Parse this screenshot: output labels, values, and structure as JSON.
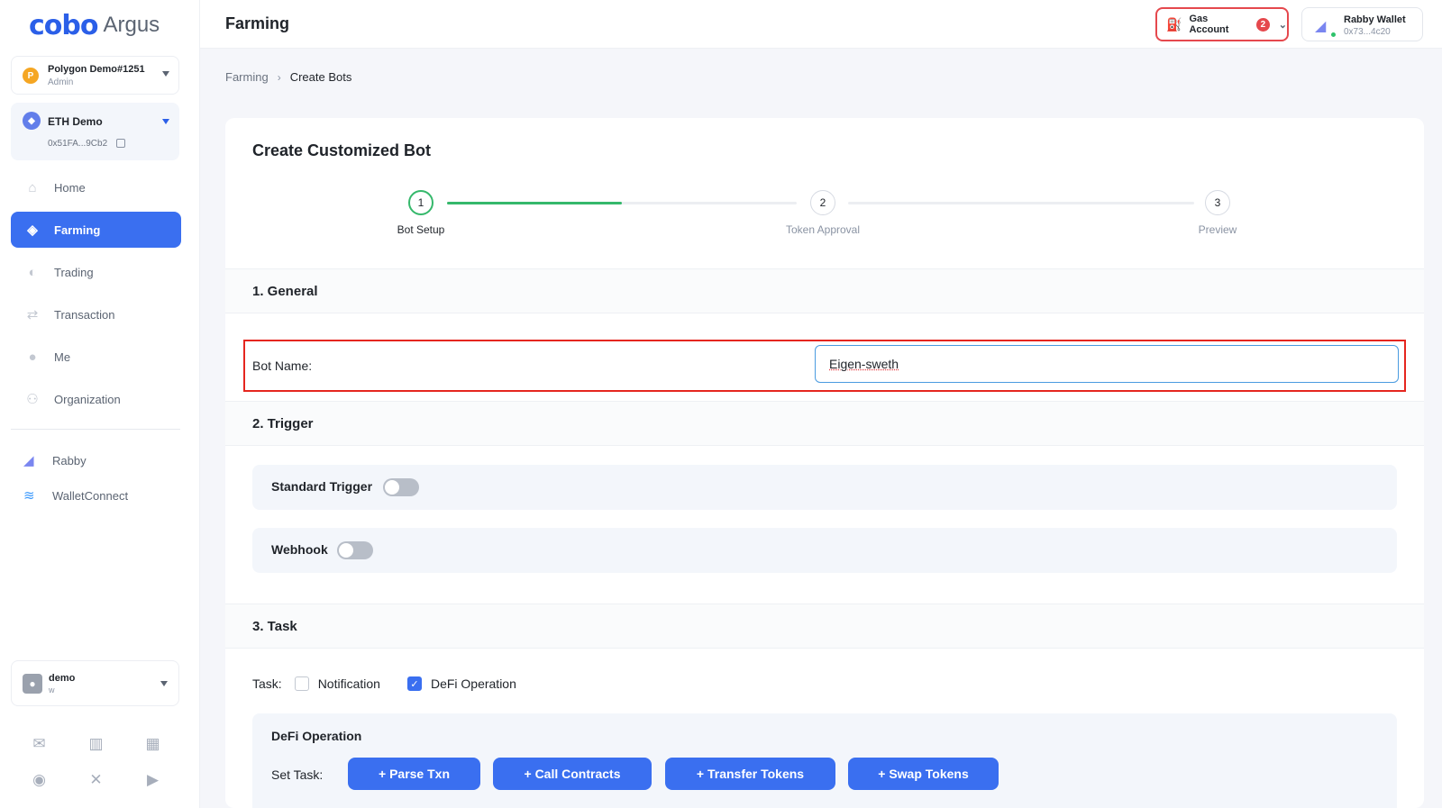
{
  "brand": {
    "mark": "cobo",
    "word": "Argus"
  },
  "accounts": [
    {
      "initial": "P",
      "name": "Polygon Demo#1251",
      "sub": "Admin"
    },
    {
      "initial": "◆",
      "name": "ETH Demo",
      "sub": "0x51FA...9Cb2"
    }
  ],
  "nav": [
    {
      "label": "Home",
      "icon": "home-icon",
      "glyph": "⌂"
    },
    {
      "label": "Farming",
      "icon": "farming-icon",
      "glyph": "◈"
    },
    {
      "label": "Trading",
      "icon": "trading-icon",
      "glyph": "◐"
    },
    {
      "label": "Transaction",
      "icon": "transaction-icon",
      "glyph": "⇄"
    },
    {
      "label": "Me",
      "icon": "person-icon",
      "glyph": "●"
    },
    {
      "label": "Organization",
      "icon": "group-icon",
      "glyph": "⚇"
    }
  ],
  "extensions": [
    {
      "label": "Rabby",
      "icon": "rabby-icon",
      "glyph": "◢"
    },
    {
      "label": "WalletConnect",
      "icon": "walletconnect-icon",
      "glyph": "≋"
    }
  ],
  "user": {
    "name": "demo",
    "sub": "w"
  },
  "footer_icons": [
    "mail-icon",
    "book-icon",
    "map-icon",
    "discord-icon",
    "x-icon",
    "youtube-icon"
  ],
  "topbar": {
    "title": "Farming",
    "gas_label": "Gas Account",
    "gas_count": "2",
    "wallet_name": "Rabby Wallet",
    "wallet_addr": "0x73...4c20"
  },
  "breadcrumb": {
    "parent": "Farming",
    "current": "Create Bots"
  },
  "card": {
    "title": "Create Customized Bot",
    "steps": [
      {
        "num": "1",
        "label": "Bot Setup"
      },
      {
        "num": "2",
        "label": "Token Approval"
      },
      {
        "num": "3",
        "label": "Preview"
      }
    ],
    "progress": 0.5,
    "sections": {
      "general": "1. General",
      "trigger": "2. Trigger",
      "task": "3. Task"
    },
    "bot_name_label": "Bot Name:",
    "bot_name_value": "Eigen-sweth",
    "triggers": [
      {
        "label": "Standard Trigger",
        "enabled": false
      },
      {
        "label": "Webhook",
        "enabled": false
      }
    ],
    "task_label": "Task:",
    "task_options": [
      {
        "label": "Notification",
        "checked": false
      },
      {
        "label": "DeFi Operation",
        "checked": true
      }
    ],
    "defi": {
      "title": "DeFi Operation",
      "set_task_label": "Set Task:",
      "buttons": [
        "+ Parse Txn",
        "+ Call Contracts",
        "+ Transfer Tokens",
        "+ Swap Tokens"
      ]
    }
  }
}
